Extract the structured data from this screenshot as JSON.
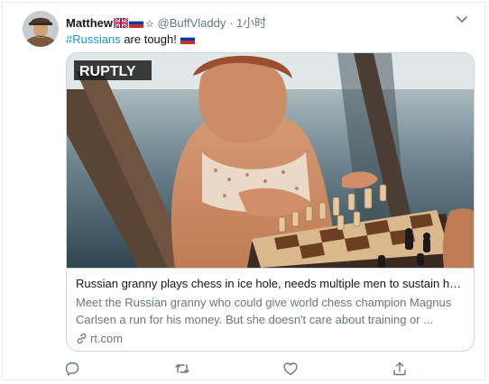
{
  "tweet": {
    "display_name": "Matthew",
    "badge_glyph": "☆",
    "handle": "@BuffVladdy",
    "separator": "·",
    "time": "1小时",
    "text_hashtag": "#Russians",
    "text_rest": " are tough!"
  },
  "card": {
    "watermark": "RUPTLY",
    "title": "Russian granny plays chess in ice hole, needs multiple men to sustain her...",
    "description_line1": "Meet the Russian granny who could give world chess champion Magnus",
    "description_line2": "Carlsen a run for his money. But she doesn't care about training or ...",
    "domain": "rt.com"
  },
  "icons": {
    "flags": [
      "uk-flag-icon",
      "russia-flag-icon",
      "russia-flag-icon"
    ],
    "caret": "chevron-down-icon",
    "actions": [
      "reply-icon",
      "retweet-icon",
      "like-icon",
      "share-icon"
    ],
    "link": "link-icon"
  },
  "colors": {
    "link_blue": "#1b95e0",
    "secondary_text": "#657786",
    "border": "#ccd6dd"
  }
}
